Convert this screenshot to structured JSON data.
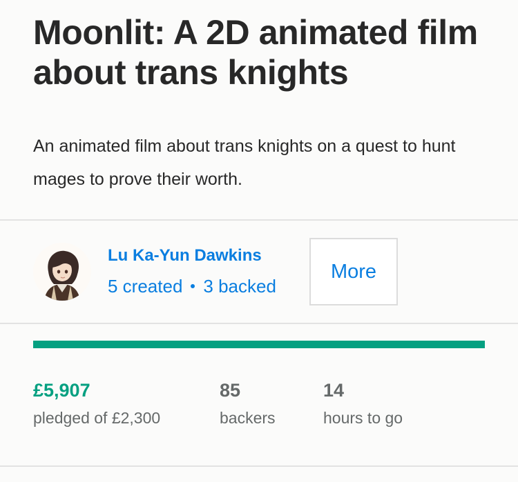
{
  "project": {
    "title": "Moonlit: A 2D animated film about trans knights",
    "blurb": "An animated film about trans knights on a quest to hunt mages to prove their worth."
  },
  "creator": {
    "name": "Lu Ka-Yun Dawkins",
    "created": "5 created",
    "backed": "3 backed",
    "more_label": "More"
  },
  "funding": {
    "progress_fraction": 1.0,
    "progress_color": "#05a081",
    "pledged_amount": "£5,907",
    "pledged_label": "pledged of £2,300",
    "backers_count": "85",
    "backers_label": "backers",
    "time_value": "14",
    "time_label": "hours to go"
  },
  "colors": {
    "link": "#0a7ee0",
    "success": "#05a081",
    "text": "#282828",
    "muted": "#656969"
  }
}
